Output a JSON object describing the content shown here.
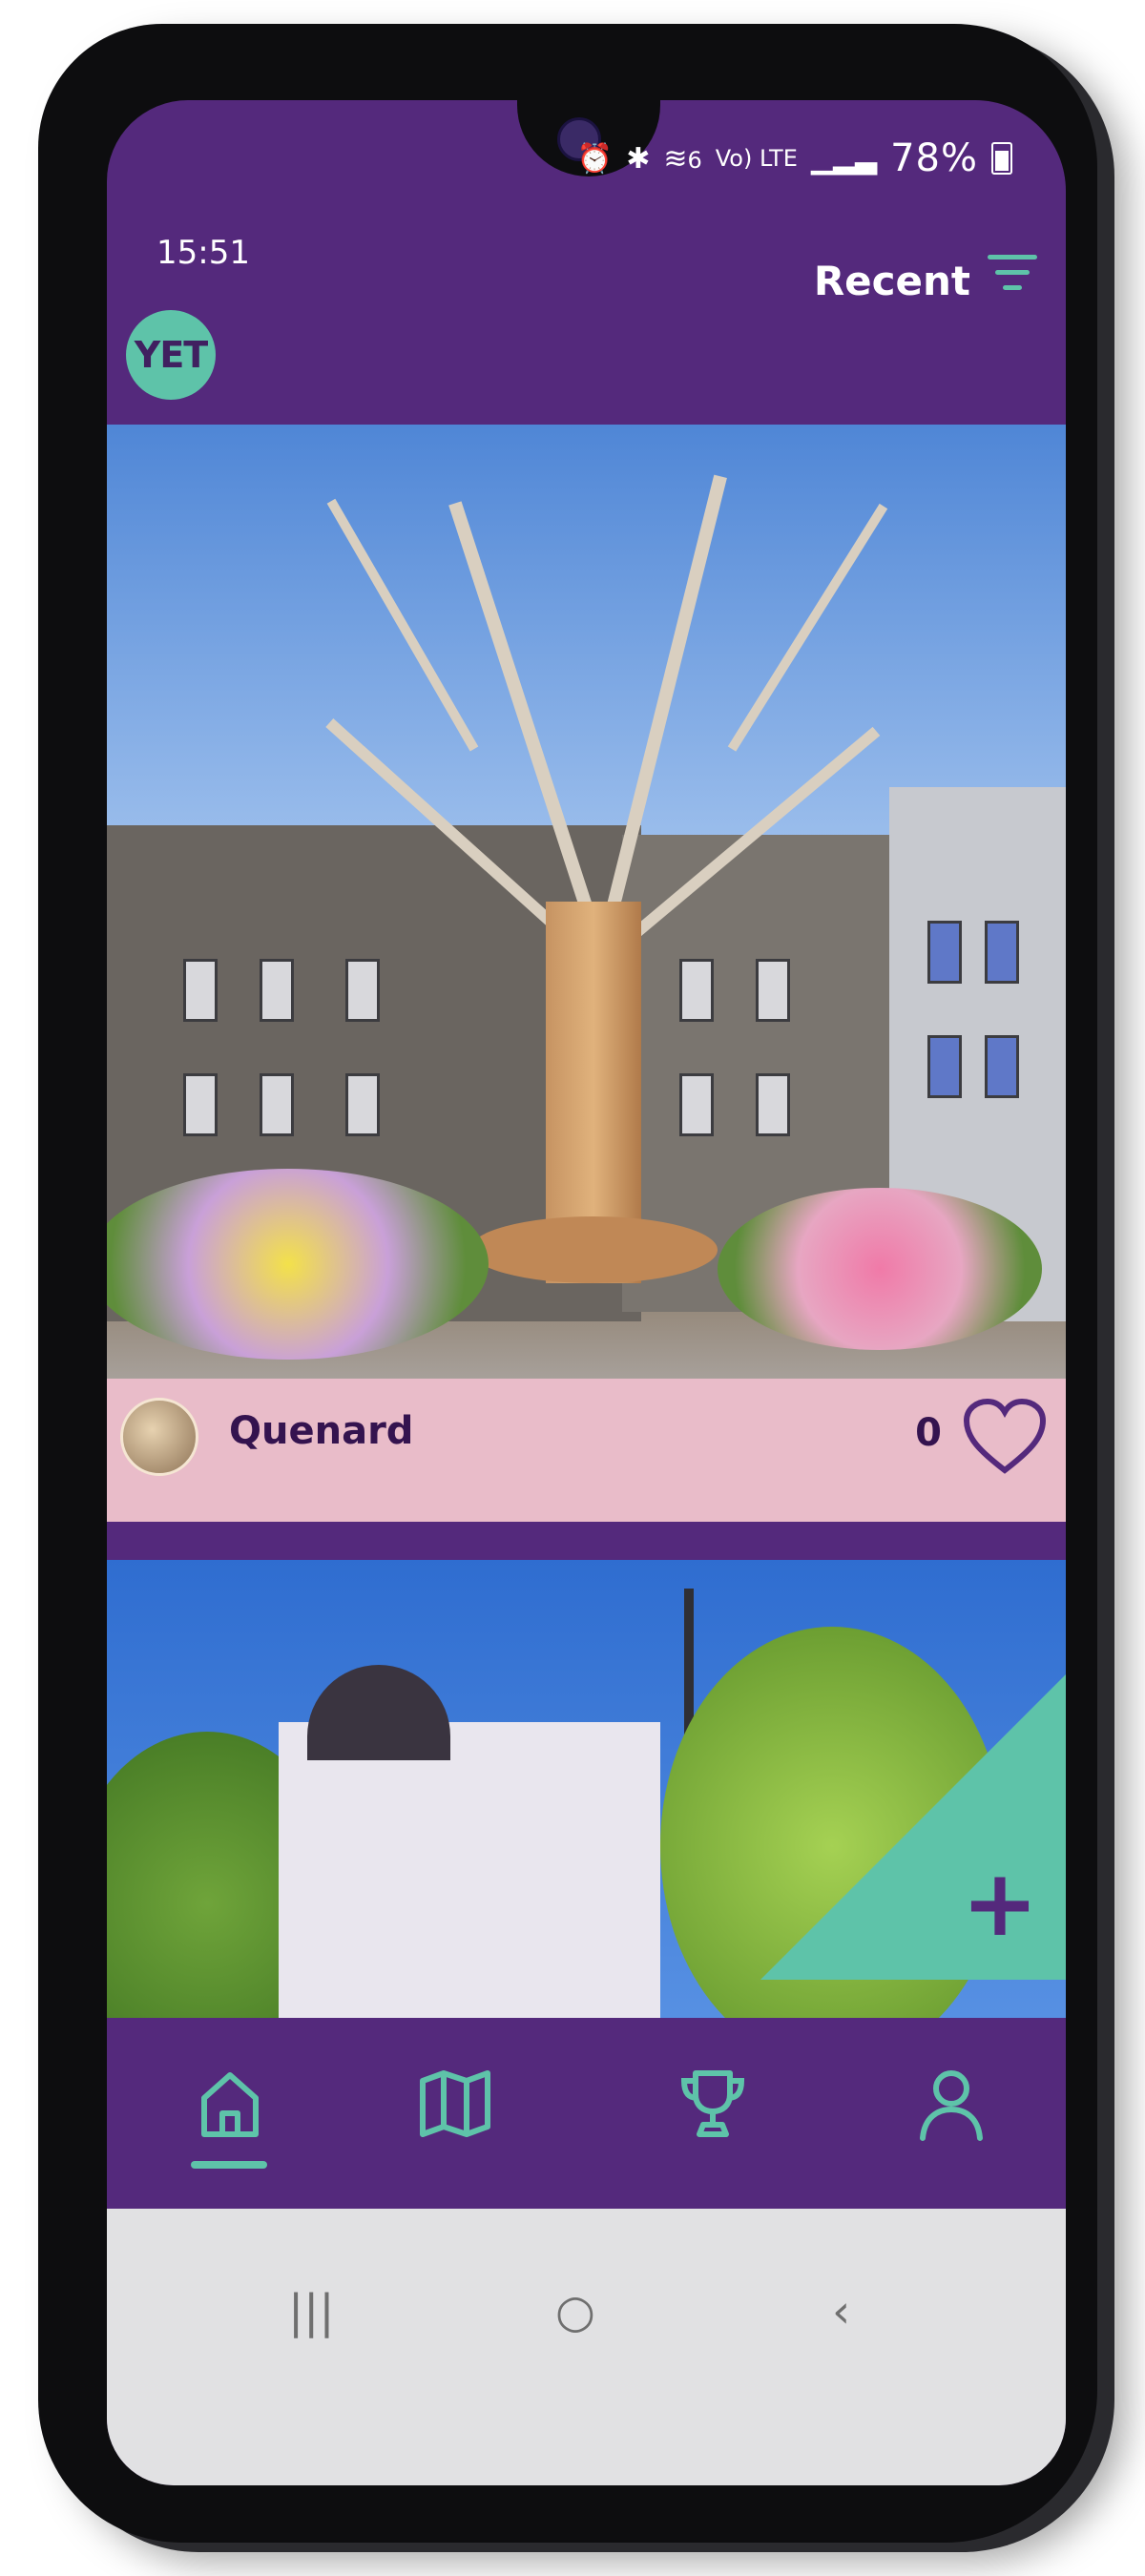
{
  "status_bar": {
    "time": "15:51",
    "battery_percent": "78%",
    "network_label": "Vo) LTE",
    "wifi_label": "6"
  },
  "header": {
    "logo_text": "YET",
    "sort_label": "Recent"
  },
  "feed": {
    "posts": [
      {
        "username": "Quenard",
        "likes": "0"
      }
    ]
  },
  "add_button": {
    "label": "+"
  },
  "bottom_nav": {
    "items": [
      {
        "icon": "home-icon"
      },
      {
        "icon": "map-icon"
      },
      {
        "icon": "trophy-icon"
      },
      {
        "icon": "profile-icon"
      }
    ]
  },
  "system_nav": {
    "recents": "|||",
    "home": "○",
    "back": "‹"
  },
  "colors": {
    "primary": "#54297c",
    "accent": "#5ec3a9",
    "card": "#e9bcc9"
  }
}
